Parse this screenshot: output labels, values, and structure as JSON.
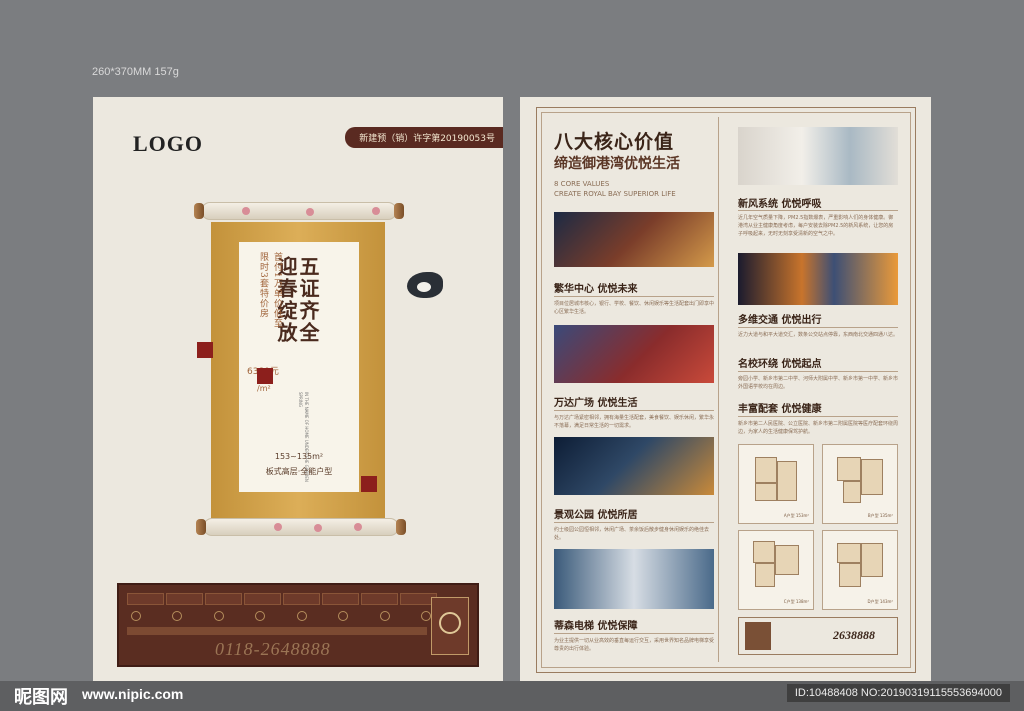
{
  "spec_text": "260*370MM   157g",
  "left": {
    "logo": "LOGO",
    "permit": "新建预（销）许字第20190053号",
    "slogan_a": "五证齐全",
    "slogan_b": "迎春绽放",
    "offer_a": "首付1万单价低至",
    "offer_b": "限时3套特价房",
    "price": "6380元",
    "unit": "/m²",
    "eng": "IN THE NAME OF HOME UNDER THE GARDEN SPRING",
    "area": "153~135m²",
    "house_type": "板式高层·全能户型",
    "hotline": "0118-2648888"
  },
  "right": {
    "title": "八大核心价值",
    "subtitle": "缔造御港湾优悦生活",
    "eng_1": "8 CORE VALUES",
    "eng_2": "CREATE ROYAL BAY SUPERIOR LIFE",
    "sections_left": [
      {
        "title": "繁华中心 优悦未来",
        "text": "项目位居城市核心，银行、学校、餐饮、休闲娱乐等生活配套出门即享中心区繁华生活。"
      },
      {
        "title": "万达广场 优悦生活",
        "text": "与万达广场紧密相邻，拥有海量生活配套，美食餐饮、娱乐休闲，繁华永不落幕，满足日常生活的一切需求。"
      },
      {
        "title": "景观公园 优悦所居",
        "text": "约士级园公园恒相邻，休闲广场、茶余饭后散步健身休闲娱乐的绝佳去处。"
      },
      {
        "title": "蒂森电梯 优悦保障",
        "text": "为业主提供一切从业高效的垂直每运行交互，采用世界知名品牌电梯享受尊贵的出行体验。"
      }
    ],
    "sections_right": [
      {
        "title": "新风系统 优悦呼吸",
        "text": "近几年空气质量下降，PM2.5指数爆表，严重影响人们的身体健康。御港湾从业主健康角度考虑，每户安装去除PM2.5的新风系统，让您的房子呼吸起来，无时无刻享受清新的空气之中。"
      },
      {
        "title": "多维交通 优悦出行",
        "text": "近力大道与和平大道交汇，数条公交站点停靠，东西南北交通四通八达。"
      },
      {
        "title": "名校环绕 优悦起点",
        "text": "旁园小学、新乡市第二中学、河师大附属中学、新乡市第一中学、新乡市外国语学校均在周边。"
      },
      {
        "title": "丰富配套 优悦健康",
        "text": "新乡市第二人民医院、公立医院、新乡市第二附属医院等医疗配套环绕周边，为家人的生活健康保驾护航。"
      }
    ],
    "plans": [
      {
        "label": "A户型  153m²"
      },
      {
        "label": "B户型  135m²"
      },
      {
        "label": "C户型  138m²"
      },
      {
        "label": "D户型  143m²"
      }
    ],
    "hotline": "2638888"
  },
  "watermark": {
    "brand": "昵图网",
    "url": "www.nipic.com",
    "id": "ID:10488408 NO:20190319115553694000"
  },
  "colors": {
    "background": "#7b7d80",
    "paper": "#ece8df",
    "brown": "#5a2d21",
    "gold": "#c3923b"
  }
}
